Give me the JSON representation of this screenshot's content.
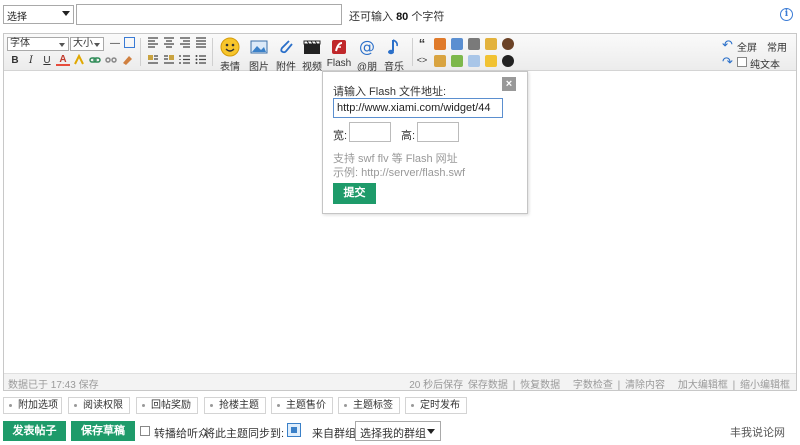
{
  "top": {
    "category_value": "选择",
    "char_remaining_prefix": "还可输入",
    "char_remaining_count": "80",
    "char_remaining_suffix": "个字符",
    "info_glyph": "i"
  },
  "toolbar": {
    "font_label": "字体",
    "size_label": "大小",
    "bold": "B",
    "italic": "I",
    "underline": "U",
    "font_color": "A",
    "emoji_label": "表情",
    "image_label": "图片",
    "attachment_label": "附件",
    "video_label": "视频",
    "flash_label": "Flash",
    "at_label": "@朋",
    "music_label": "音乐",
    "quote_glyph": "“",
    "code_glyph": "<>",
    "fullscreen_label": "全屏",
    "common_label": "常用",
    "plain_text_label": "纯文本"
  },
  "flash_popup": {
    "title": "请输入 Flash 文件地址:",
    "url_value": "http://www.xiami.com/widget/44",
    "width_label": "宽:",
    "height_label": "高:",
    "hint_line1": "支持 swf flv 等 Flash 网址",
    "hint_line2": "示例: http://server/flash.swf",
    "submit_label": "提交",
    "close_glyph": "×"
  },
  "status_bar": {
    "saved_text": "数据已于 17:43 保存",
    "autosave": "20 秒后保存",
    "save_data": "保存数据",
    "restore_data": "恢复数据",
    "word_check": "字数检查",
    "clear_content": "清除内容",
    "enlarge": "加大编辑框",
    "shrink": "缩小编辑框",
    "divider": "|"
  },
  "options": [
    "附加选项",
    "阅读权限",
    "回帖奖励",
    "抢楼主题",
    "主题售价",
    "主题标签",
    "定时发布"
  ],
  "bottom": {
    "publish_label": "发表帖子",
    "draft_label": "保存草稿",
    "forward_label": "转播给听众",
    "sync_label": "将此主题同步到:",
    "group_label": "来自群组:",
    "group_select_value": "选择我的群组",
    "watermark": "丰我说论网"
  },
  "colors": {
    "accent_green": "#1e9b6a",
    "link_blue": "#2a6fc9"
  }
}
